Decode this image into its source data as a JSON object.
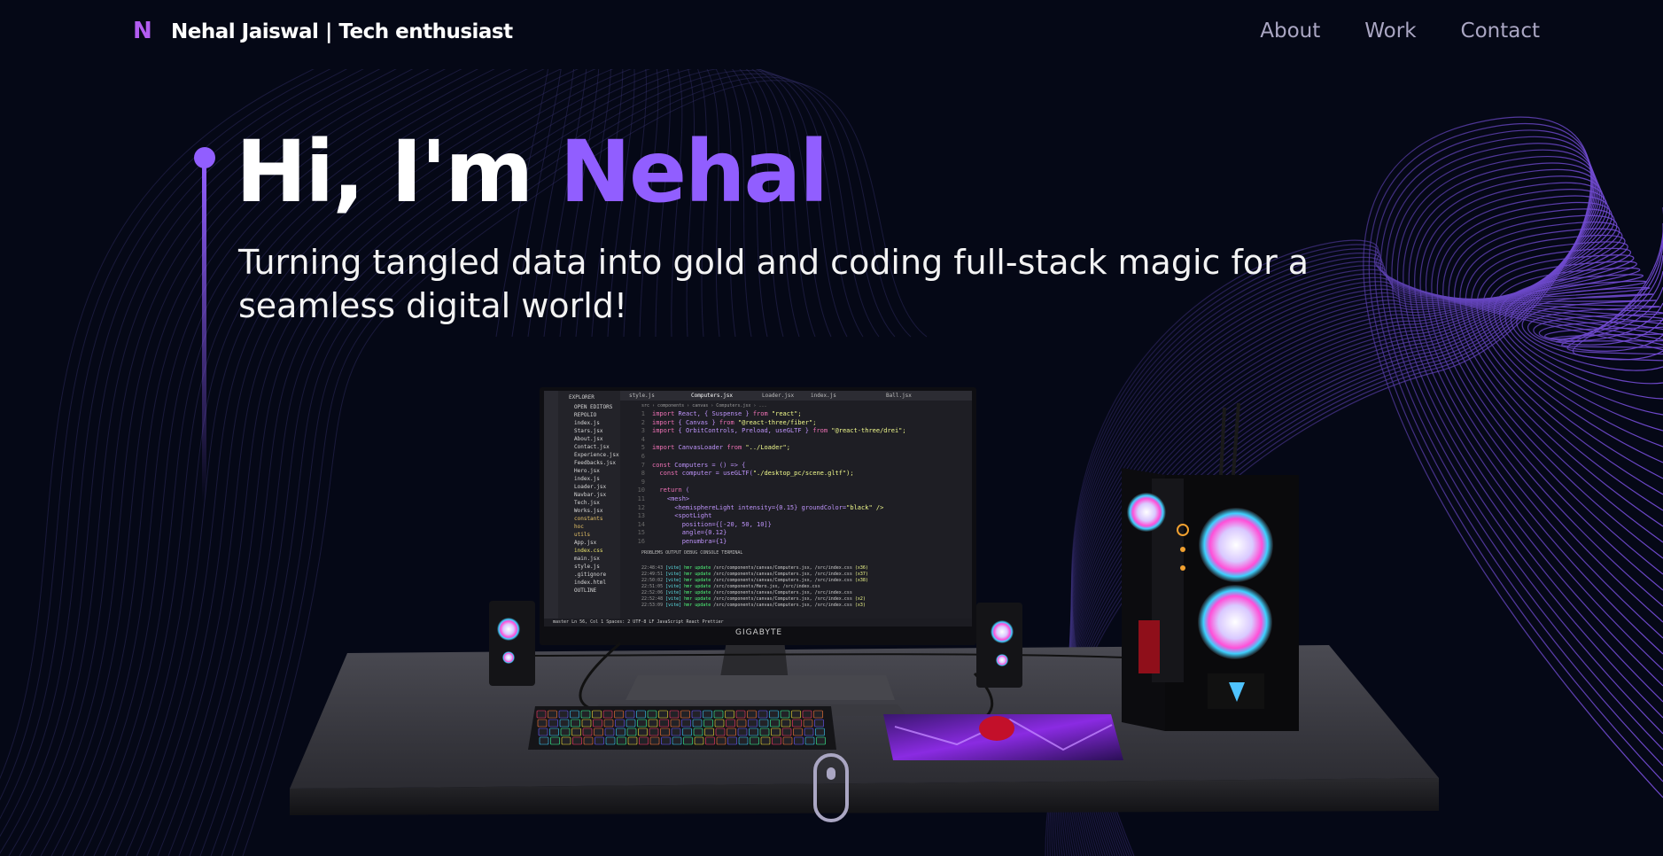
{
  "navbar": {
    "logo": "N",
    "brand": "Nehal Jaiswal  | Tech enthusiast",
    "links": [
      {
        "label": "About"
      },
      {
        "label": "Work"
      },
      {
        "label": "Contact"
      }
    ]
  },
  "hero": {
    "greeting": "Hi, I'm ",
    "name": "Nehal",
    "subtitle": "Turning tangled data into gold and coding full-stack magic for a seamless digital world!"
  },
  "scene": {
    "monitor_brand": "GIGABYTE",
    "editor": {
      "explorer_title": "EXPLORER",
      "open_editors": "OPEN EDITORS",
      "project": "REPOLIO",
      "files": [
        {
          "name": "index.js",
          "kind": "file"
        },
        {
          "name": "Stars.jsx",
          "kind": "file"
        },
        {
          "name": "About.jsx",
          "kind": "file"
        },
        {
          "name": "Contact.jsx",
          "kind": "file"
        },
        {
          "name": "Experience.jsx",
          "kind": "file"
        },
        {
          "name": "Feedbacks.jsx",
          "kind": "file"
        },
        {
          "name": "Hero.jsx",
          "kind": "file"
        },
        {
          "name": "index.js",
          "kind": "file"
        },
        {
          "name": "Loader.jsx",
          "kind": "file"
        },
        {
          "name": "Navbar.jsx",
          "kind": "file"
        },
        {
          "name": "Tech.jsx",
          "kind": "file"
        },
        {
          "name": "Works.jsx",
          "kind": "file"
        },
        {
          "name": "constants",
          "kind": "folder"
        },
        {
          "name": "hoc",
          "kind": "folder"
        },
        {
          "name": "utils",
          "kind": "folder"
        },
        {
          "name": "App.jsx",
          "kind": "file"
        },
        {
          "name": "index.css",
          "kind": "active"
        },
        {
          "name": "main.jsx",
          "kind": "file"
        },
        {
          "name": "style.js",
          "kind": "file"
        },
        {
          "name": ".gitignore",
          "kind": "file"
        },
        {
          "name": "index.html",
          "kind": "file"
        },
        {
          "name": "OUTLINE",
          "kind": "file"
        }
      ],
      "tabs": [
        "style.js",
        "Computers.jsx",
        "Loader.jsx",
        "index.js",
        "Ball.jsx"
      ],
      "breadcrumb": "src › components › canvas › Computers.jsx › ...",
      "code": [
        {
          "n": "1",
          "a": "import",
          "b": " React, { Suspense } ",
          "c": "from",
          "d": " \"react\";"
        },
        {
          "n": "2",
          "a": "import",
          "b": " { Canvas } ",
          "c": "from",
          "d": " \"@react-three/fiber\";"
        },
        {
          "n": "3",
          "a": "import",
          "b": " { OrbitControls, Preload, useGLTF } ",
          "c": "from",
          "d": " \"@react-three/drei\";"
        },
        {
          "n": "4",
          "a": "",
          "b": "",
          "c": "",
          "d": ""
        },
        {
          "n": "5",
          "a": "import",
          "b": " CanvasLoader ",
          "c": "from",
          "d": " \"../Loader\";"
        },
        {
          "n": "6",
          "a": "",
          "b": "",
          "c": "",
          "d": ""
        },
        {
          "n": "7",
          "a": "const",
          "b": " Computers = () => {",
          "c": "",
          "d": ""
        },
        {
          "n": "8",
          "a": "  const",
          "b": " computer = useGLTF(",
          "c": "",
          "d": "\"./desktop_pc/scene.gltf\");"
        },
        {
          "n": "9",
          "a": "",
          "b": "",
          "c": "",
          "d": ""
        },
        {
          "n": "10",
          "a": "  return",
          "b": " (",
          "c": "",
          "d": ""
        },
        {
          "n": "11",
          "a": "",
          "b": "    <mesh>",
          "c": "",
          "d": ""
        },
        {
          "n": "12",
          "a": "",
          "b": "      <hemisphereLight intensity={0.15} groundColor=",
          "c": "",
          "d": "\"black\" />"
        },
        {
          "n": "13",
          "a": "",
          "b": "      <spotLight",
          "c": "",
          "d": ""
        },
        {
          "n": "14",
          "a": "",
          "b": "        position={[-20, 50, 10]}",
          "c": "",
          "d": ""
        },
        {
          "n": "15",
          "a": "",
          "b": "        angle={0.12}",
          "c": "",
          "d": ""
        },
        {
          "n": "16",
          "a": "",
          "b": "        penumbra={1}",
          "c": "",
          "d": ""
        }
      ],
      "panel_tabs": "PROBLEMS    OUTPUT    DEBUG CONSOLE    TERMINAL",
      "terminal": [
        {
          "time": "22:48:43",
          "msg": "/src/components/canvas/Computers.jsx, /src/index.css",
          "x": "(x36)"
        },
        {
          "time": "22:49:51",
          "msg": "/src/components/canvas/Computers.jsx, /src/index.css",
          "x": "(x37)"
        },
        {
          "time": "22:50:02",
          "msg": "/src/components/canvas/Computers.jsx, /src/index.css",
          "x": "(x38)"
        },
        {
          "time": "22:51:05",
          "msg": "/src/components/Hero.jsx, /src/index.css",
          "x": ""
        },
        {
          "time": "22:52:06",
          "msg": "/src/components/canvas/Computers.jsx, /src/index.css",
          "x": ""
        },
        {
          "time": "22:52:48",
          "msg": "/src/components/canvas/Computers.jsx, /src/index.css",
          "x": "(x2)"
        },
        {
          "time": "22:53:09",
          "msg": "/src/components/canvas/Computers.jsx, /src/index.css",
          "x": "(x3)"
        }
      ],
      "statusbar": "master    Ln 56, Col 1   Spaces: 2   UTF-8   LF   JavaScript React   Prettier"
    }
  },
  "colors": {
    "background": "#050816",
    "accent": "#915eff",
    "secondary_text": "#aaa6c3"
  }
}
